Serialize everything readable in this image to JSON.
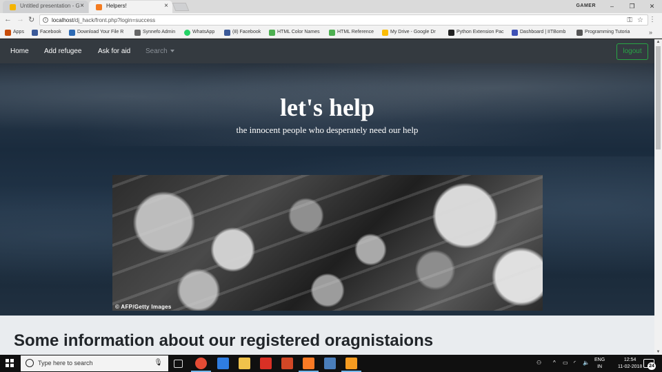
{
  "browser": {
    "tabs": [
      {
        "title": "Untitled presentation - G",
        "active": false,
        "favicon_color": "#f4b400"
      },
      {
        "title": "Helpers!",
        "active": true,
        "favicon_color": "#f47b20"
      }
    ],
    "profile": "GAMER",
    "url_host": "localhost",
    "url_path": "/dj_hack/front.php?login=success",
    "bookmarks": [
      {
        "label": "Apps",
        "color": "#c84c09"
      },
      {
        "label": "Facebook",
        "color": "#3b5998"
      },
      {
        "label": "Download Your File R",
        "color": "#2d6ab4"
      },
      {
        "label": "Synnefo Admin",
        "color": "#666666"
      },
      {
        "label": "WhatsApp",
        "color": "#25d366"
      },
      {
        "label": "(8) Facebook",
        "color": "#3b5998"
      },
      {
        "label": "HTML Color Names",
        "color": "#4caf50"
      },
      {
        "label": "HTML Reference",
        "color": "#4caf50"
      },
      {
        "label": "My Drive - Google Dr",
        "color": "#fbbc04"
      },
      {
        "label": "Python Extension Pac",
        "color": "#222222"
      },
      {
        "label": "Dashboard | IITBomb",
        "color": "#3f51b5"
      },
      {
        "label": "Programming Tutoria",
        "color": "#555555"
      }
    ]
  },
  "navbar": {
    "links": [
      "Home",
      "Add refugee",
      "Ask for aid"
    ],
    "search_label": "Search",
    "logout_label": "logout",
    "accent_color": "#28a745"
  },
  "hero": {
    "title": "let's help",
    "subtitle": "the innocent people who desperately need our help",
    "photo_credit": "© AFP/Getty Images"
  },
  "info": {
    "heading": "Some information about our registered oragnistaions"
  },
  "taskbar": {
    "search_placeholder": "Type here to search",
    "language_top": "ENG",
    "language_bottom": "IN",
    "time": "12:54",
    "date": "11-02-2018",
    "notification_count": "24",
    "apps": [
      {
        "name": "chrome",
        "color": "#e44b34",
        "active": true
      },
      {
        "name": "edge",
        "color": "#2f7de1",
        "active": false
      },
      {
        "name": "file-explorer",
        "color": "#f0c24b",
        "active": false
      },
      {
        "name": "mail",
        "color": "#d93025",
        "active": false
      },
      {
        "name": "powerpoint",
        "color": "#d24726",
        "active": false
      },
      {
        "name": "xampp",
        "color": "#fb7a24",
        "active": true
      },
      {
        "name": "app-7",
        "color": "#4a7ebb",
        "active": false
      },
      {
        "name": "sublime-text",
        "color": "#f59b20",
        "active": true
      }
    ]
  }
}
